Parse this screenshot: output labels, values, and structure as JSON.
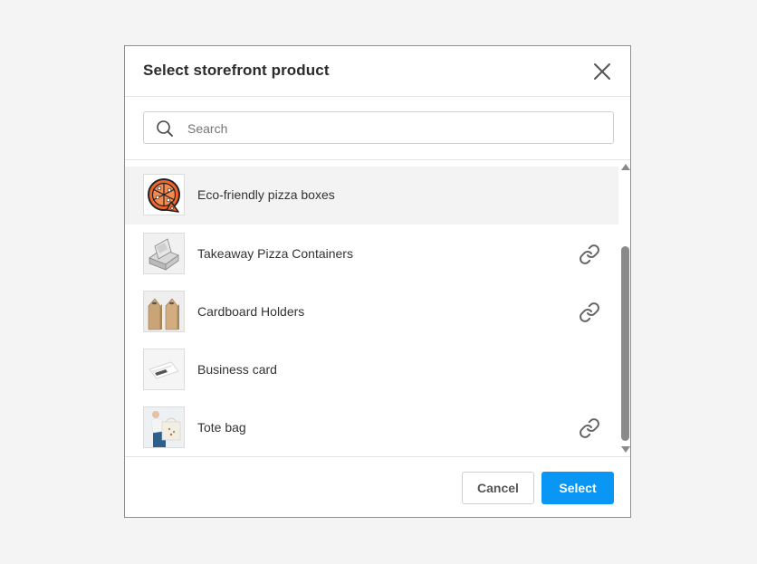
{
  "dialog": {
    "title": "Select storefront product",
    "close_icon": "close-icon"
  },
  "search": {
    "placeholder": "Search",
    "value": "",
    "icon": "search-icon"
  },
  "products": [
    {
      "label": "Eco-friendly pizza boxes",
      "thumbnail": "pizza-icon",
      "linked": false,
      "selected": true
    },
    {
      "label": "Takeaway Pizza Containers",
      "thumbnail": "pizza-container-photo",
      "linked": true,
      "selected": false
    },
    {
      "label": "Cardboard Holders",
      "thumbnail": "cardboard-holders-photo",
      "linked": true,
      "selected": false
    },
    {
      "label": "Business card",
      "thumbnail": "business-card-photo",
      "linked": false,
      "selected": false
    },
    {
      "label": "Tote bag",
      "thumbnail": "tote-bag-photo",
      "linked": true,
      "selected": false
    }
  ],
  "footer": {
    "cancel_label": "Cancel",
    "select_label": "Select"
  },
  "colors": {
    "accent": "#0a96f5",
    "selected_row": "#f3f3f3",
    "pizza_orange": "#f2652a"
  }
}
